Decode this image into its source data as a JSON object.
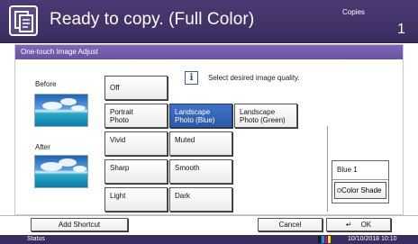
{
  "header": {
    "title": "Ready to copy. (Full Color)",
    "copies_label": "Copies",
    "copies_count": "1"
  },
  "panel": {
    "title": "One-touch Image Adjust",
    "before_label": "Before",
    "after_label": "After",
    "info_text": "Select desired image quality."
  },
  "options": {
    "off": "Off",
    "portrait": "Portrait\nPhoto",
    "landscape_blue": "Landscape\nPhoto (Blue)",
    "landscape_green": "Landscape\nPhoto (Green)",
    "vivid": "Vivid",
    "muted": "Muted",
    "sharp": "Sharp",
    "smooth": "Smooth",
    "light": "Light",
    "dark": "Dark",
    "selected": "landscape_blue"
  },
  "shade": {
    "value": "Blue 1",
    "button": "Color Shade"
  },
  "footer": {
    "add_shortcut": "Add Shortcut",
    "cancel": "Cancel",
    "ok": "OK"
  },
  "status": {
    "label": "Status",
    "datetime": "10/10/2018  10:10"
  },
  "colors": {
    "header": "#3a2c5f",
    "panel_title": "#7f66b8",
    "selected": "#2d5aa8",
    "toner": [
      "#1a1a1a",
      "#00a0e0",
      "#e0007a",
      "#ffe600"
    ]
  }
}
